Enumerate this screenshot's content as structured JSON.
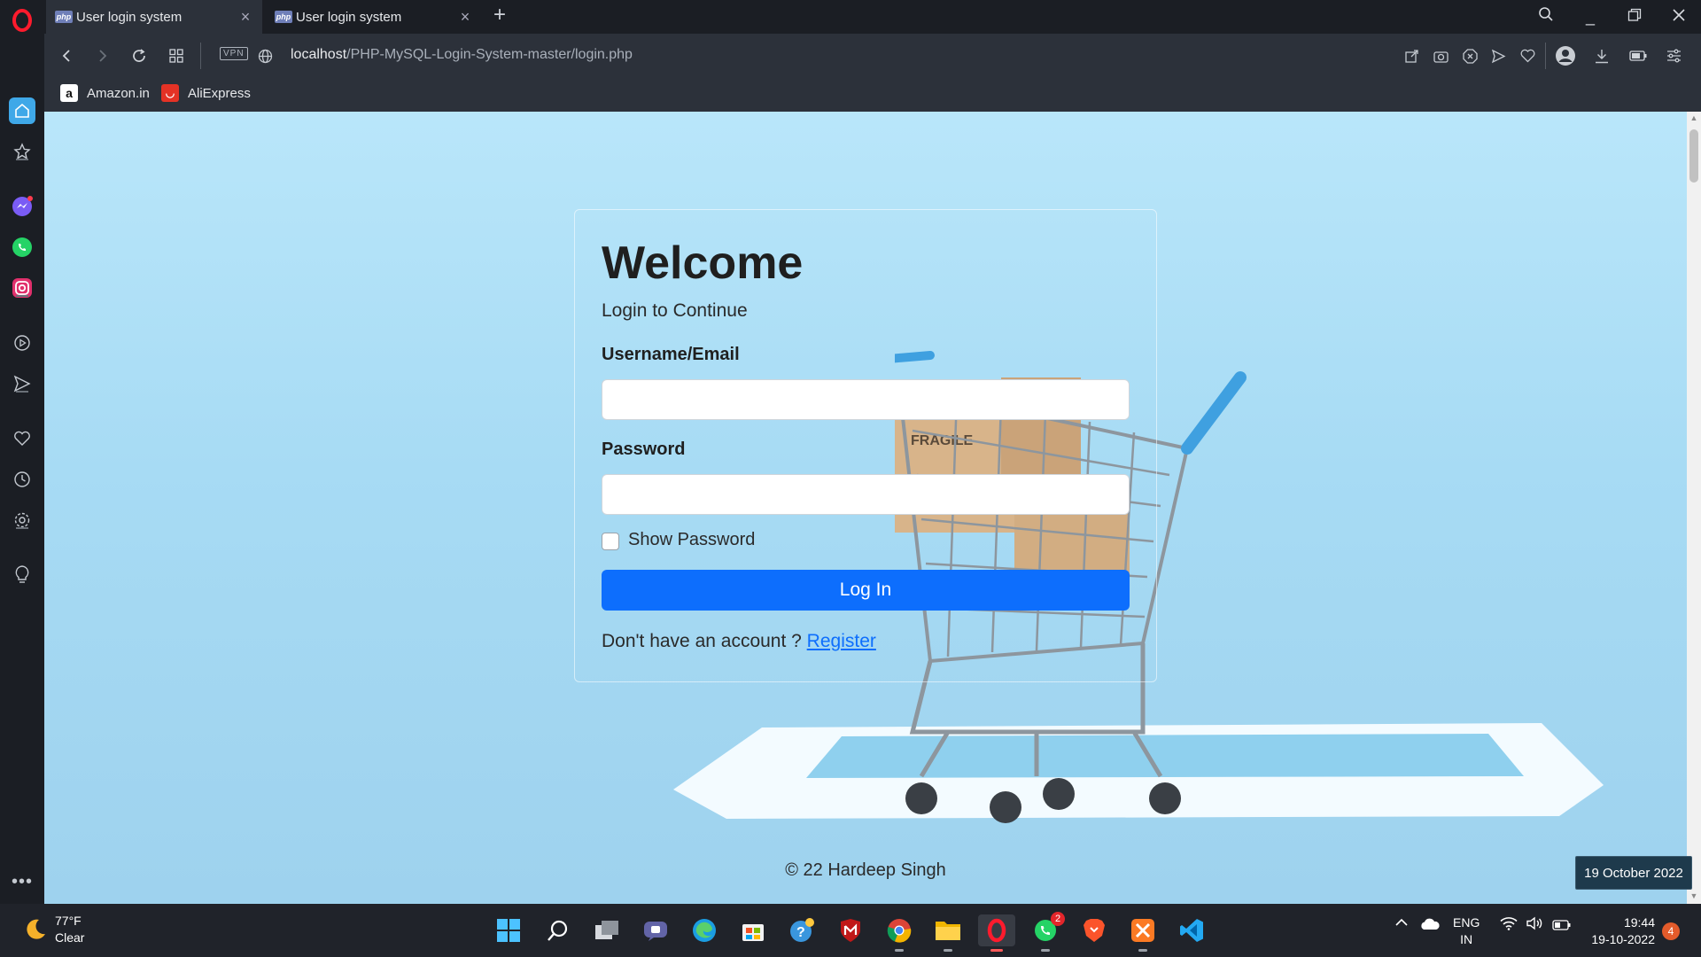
{
  "browser": {
    "tabs": [
      {
        "title": "User login system",
        "favicon": "php",
        "active": true
      },
      {
        "title": "User login system",
        "favicon": "php",
        "active": false
      }
    ],
    "address": {
      "vpn_label": "VPN",
      "url_host": "localhost",
      "url_path": "/PHP-MySQL-Login-System-master/login.php"
    },
    "bookmarks": [
      {
        "label": "Amazon.in",
        "icon": "a"
      },
      {
        "label": "AliExpress",
        "icon": "ali"
      }
    ]
  },
  "page": {
    "title": "Welcome",
    "subtitle": "Login to Continue",
    "username_label": "Username/Email",
    "username_value": "",
    "password_label": "Password",
    "password_value": "",
    "show_password_label": "Show Password",
    "login_button": "Log In",
    "register_prompt": "Don't have an account ? ",
    "register_link": "Register",
    "footer": "© 22 Hardeep Singh",
    "accent_color": "#0d6efd"
  },
  "tooltip": {
    "date": "19 October 2022"
  },
  "taskbar": {
    "weather_temp": "77°F",
    "weather_desc": "Clear",
    "lang_line1": "ENG",
    "lang_line2": "IN",
    "time": "19:44",
    "date": "19-10-2022",
    "whatsapp_badge": "2",
    "notification_count": "4"
  }
}
